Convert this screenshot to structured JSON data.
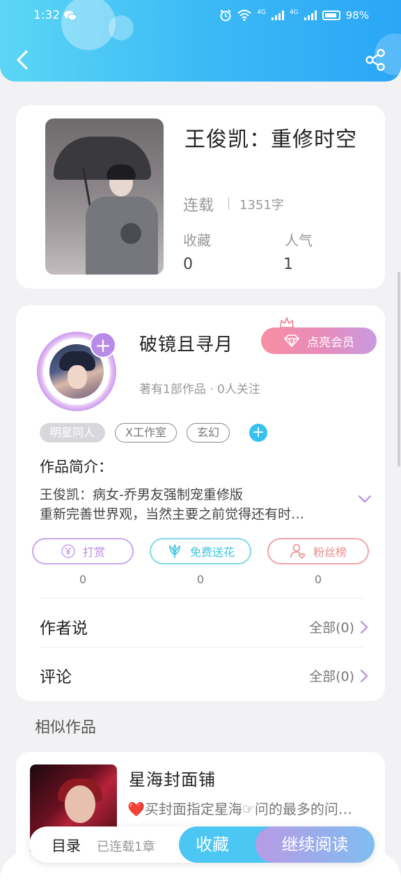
{
  "status_bar": {
    "time": "1:32",
    "network_1": "4G",
    "network_2": "4G",
    "battery": "98%"
  },
  "book": {
    "title": "王俊凯：重修时空",
    "status": "连载",
    "word_count": "1351字",
    "favorites_label": "收藏",
    "favorites_value": "0",
    "popularity_label": "人气",
    "popularity_value": "1"
  },
  "author": {
    "name": "破镜且寻月",
    "vip_button": "点亮会员",
    "meta": "著有1部作品 · 0人关注",
    "tags": [
      "明星同人",
      "X工作室",
      "玄幻"
    ],
    "tag_add": "+",
    "avatar_add": "+"
  },
  "intro": {
    "title": "作品简介：",
    "line1": "王俊凯：病女-乔男友强制宠重修版",
    "line2": "重新完善世界观，当然主要之前觉得还有时…"
  },
  "actions": [
    {
      "label": "打赏",
      "count": "0",
      "color": "#b889e6"
    },
    {
      "label": "免费送花",
      "count": "0",
      "color": "#3cc6e0"
    },
    {
      "label": "粉丝榜",
      "count": "0",
      "color": "#ee8a8e"
    }
  ],
  "rows": {
    "author_says": {
      "label": "作者说",
      "right": "全部(0)"
    },
    "comments": {
      "label": "评论",
      "right": "全部(0)"
    }
  },
  "similar": {
    "section_title": "相似作品",
    "title": "星海封面铺",
    "desc": "❤️买封面指定星海☞问的最多的问…"
  },
  "bottom_bar": {
    "toc": "目录",
    "chapters": "已连载1章",
    "favorite": "收藏",
    "continue": "继续阅读"
  },
  "icons": [
    "back-arrow-icon",
    "share-icon",
    "wechat-icon",
    "alarm-icon",
    "wifi-icon",
    "battery-icon",
    "crown-icon",
    "diamond-icon",
    "yen-icon",
    "flower-icon",
    "user-heart-icon",
    "chevron-right-icon",
    "chevron-down-icon"
  ]
}
